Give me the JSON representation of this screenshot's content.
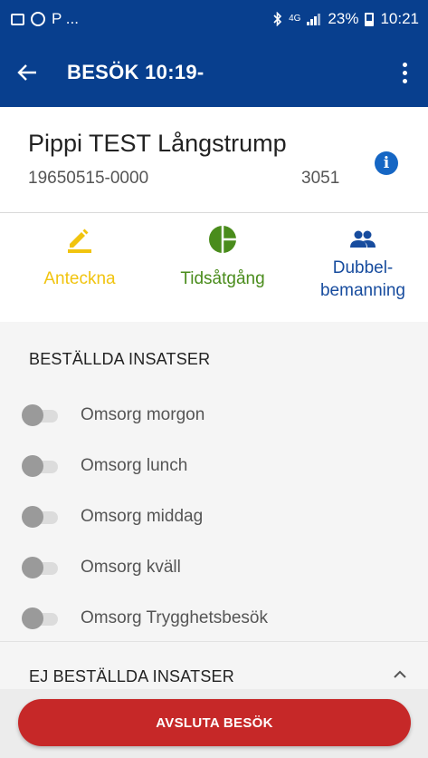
{
  "status_bar": {
    "carrier_text": "P ...",
    "network_small": "4G",
    "battery_percent": "23%",
    "time": "10:21"
  },
  "app_bar": {
    "title": "BESÖK 10:19-",
    "back_icon": "arrow-left-icon",
    "menu_icon": "more-vert-icon",
    "background_color": "#083f8e"
  },
  "patient": {
    "name": "Pippi TEST Långstrump",
    "personal_number": "19650515-0000",
    "code": "3051",
    "info_icon": "info-icon"
  },
  "actions": [
    {
      "label": "Anteckna",
      "icon": "pencil-icon",
      "color": "#f1c40f"
    },
    {
      "label": "Tidsåtgång",
      "icon": "pie-chart-icon",
      "color": "#4a8c1c"
    },
    {
      "label_line1": "Dubbel-",
      "label_line2": "bemanning",
      "icon": "people-icon",
      "color": "#174c9e"
    }
  ],
  "ordered_section": {
    "title": "BESTÄLLDA INSATSER",
    "items": [
      {
        "label": "Omsorg morgon",
        "checked": false
      },
      {
        "label": "Omsorg lunch",
        "checked": false
      },
      {
        "label": "Omsorg middag",
        "checked": false
      },
      {
        "label": "Omsorg kväll",
        "checked": false
      },
      {
        "label": "Omsorg Trygghetsbesök",
        "checked": false
      }
    ]
  },
  "unordered_section": {
    "title": "EJ BESTÄLLDA INSATSER",
    "expand_icon": "chevron-up-icon"
  },
  "footer": {
    "end_visit_label": "AVSLUTA BESÖK",
    "button_color": "#c62828"
  }
}
